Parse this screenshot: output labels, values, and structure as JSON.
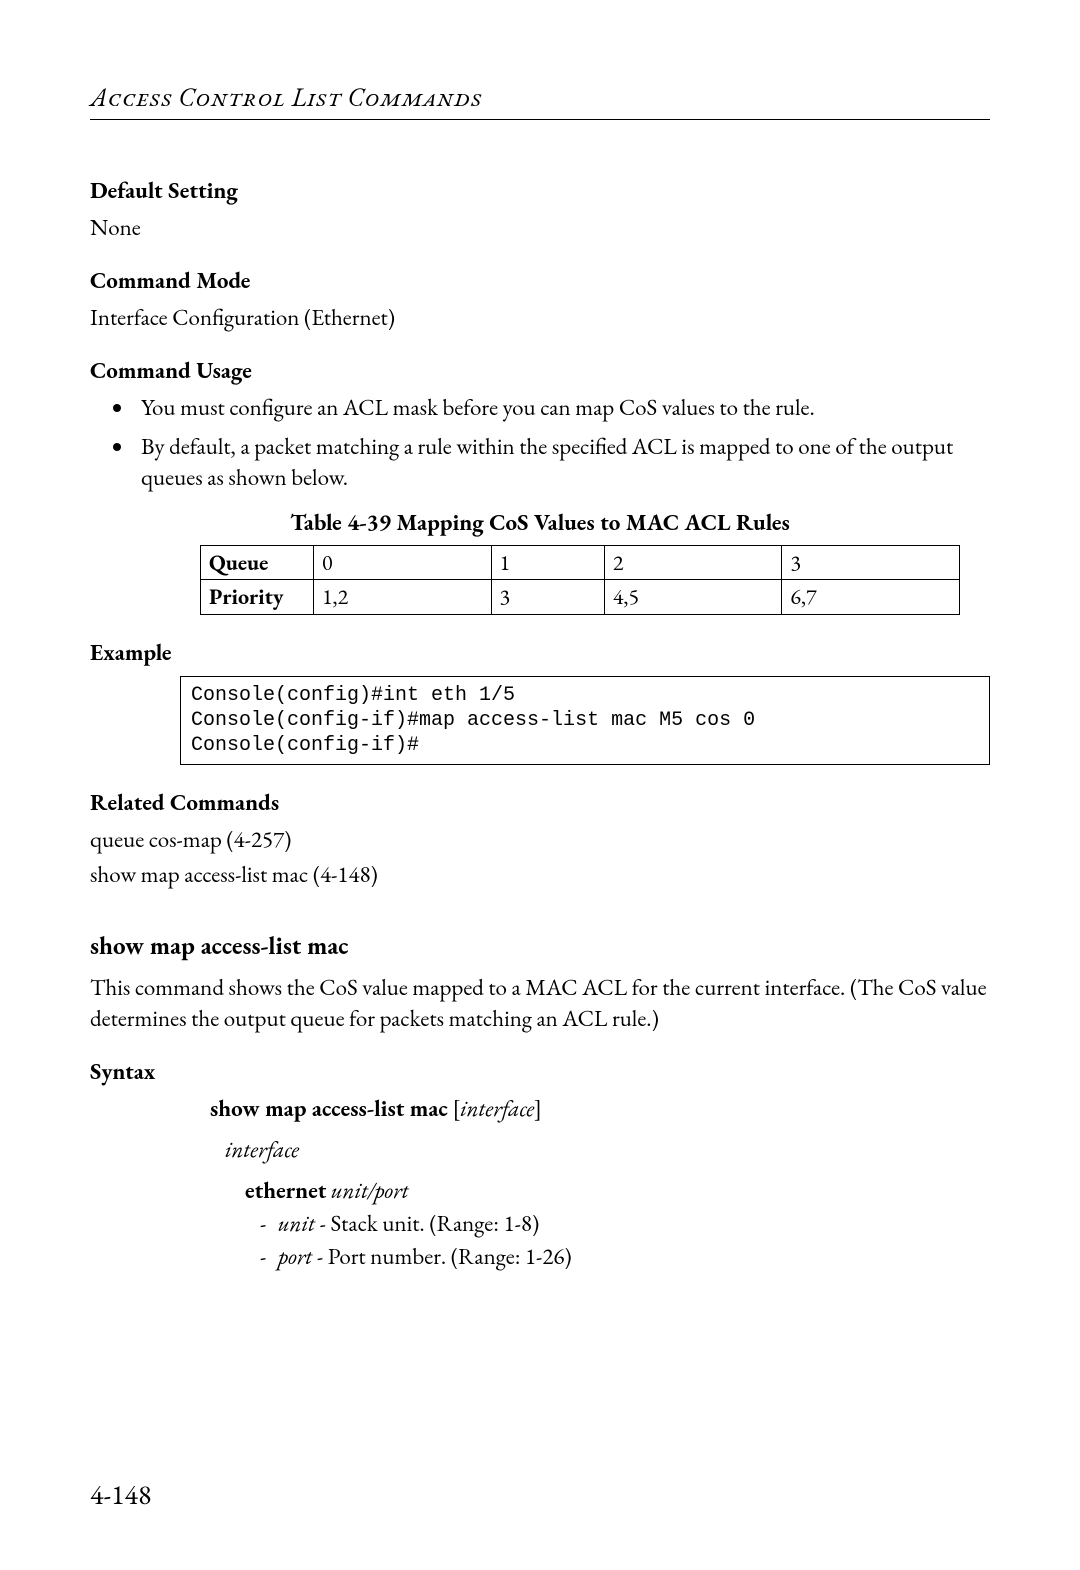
{
  "runningHead": "Access Control List Commands",
  "defaultSetting": {
    "label": "Default Setting",
    "value": "None"
  },
  "commandMode": {
    "label": "Command Mode",
    "value": "Interface Configuration (Ethernet)"
  },
  "commandUsage": {
    "label": "Command Usage",
    "bullets": [
      "You must configure an ACL mask before you can map CoS values to the rule.",
      "By default, a packet matching a rule within the specified ACL is mapped to one of the output queues as shown below."
    ]
  },
  "table": {
    "caption": "Table 4-39   Mapping CoS Values to MAC ACL Rules",
    "rowLabels": [
      "Queue",
      "Priority"
    ],
    "rows": [
      [
        "0",
        "1",
        "2",
        "3"
      ],
      [
        "1,2",
        "3",
        "4,5",
        "6,7"
      ]
    ]
  },
  "example": {
    "label": "Example",
    "console": "Console(config)#int eth 1/5\nConsole(config-if)#map access-list mac M5 cos 0\nConsole(config-if)#"
  },
  "related": {
    "label": "Related Commands",
    "items": [
      "queue cos-map (4-257)",
      "show map access-list mac (4-148)"
    ]
  },
  "showCmd": {
    "heading": "show map access-list mac",
    "description": "This command shows the CoS value mapped to a MAC ACL for the current interface. (The CoS value determines the output queue for packets matching an ACL rule.)",
    "syntaxLabel": "Syntax",
    "syntaxBold": "show map access-list mac",
    "syntaxBracketOpen": " [",
    "syntaxParam": "interface",
    "syntaxBracketClose": "]",
    "interfaceToken": "interface",
    "ethernetBold": "ethernet",
    "ethernetItalic": "unit/port",
    "unitItalic": "unit",
    "unitDesc": " - Stack unit. (Range: 1-8)",
    "portItalic": "port",
    "portDesc": " - Port number. (Range: 1-26)"
  },
  "pageNumber": "4-148",
  "chart_data": {
    "type": "table",
    "title": "Table 4-39   Mapping CoS Values to MAC ACL Rules",
    "columns": [
      "Queue 0",
      "Queue 1",
      "Queue 2",
      "Queue 3"
    ],
    "rows": [
      {
        "name": "Queue",
        "values": [
          "0",
          "1",
          "2",
          "3"
        ]
      },
      {
        "name": "Priority",
        "values": [
          "1,2",
          "3",
          "4,5",
          "6,7"
        ]
      }
    ]
  }
}
